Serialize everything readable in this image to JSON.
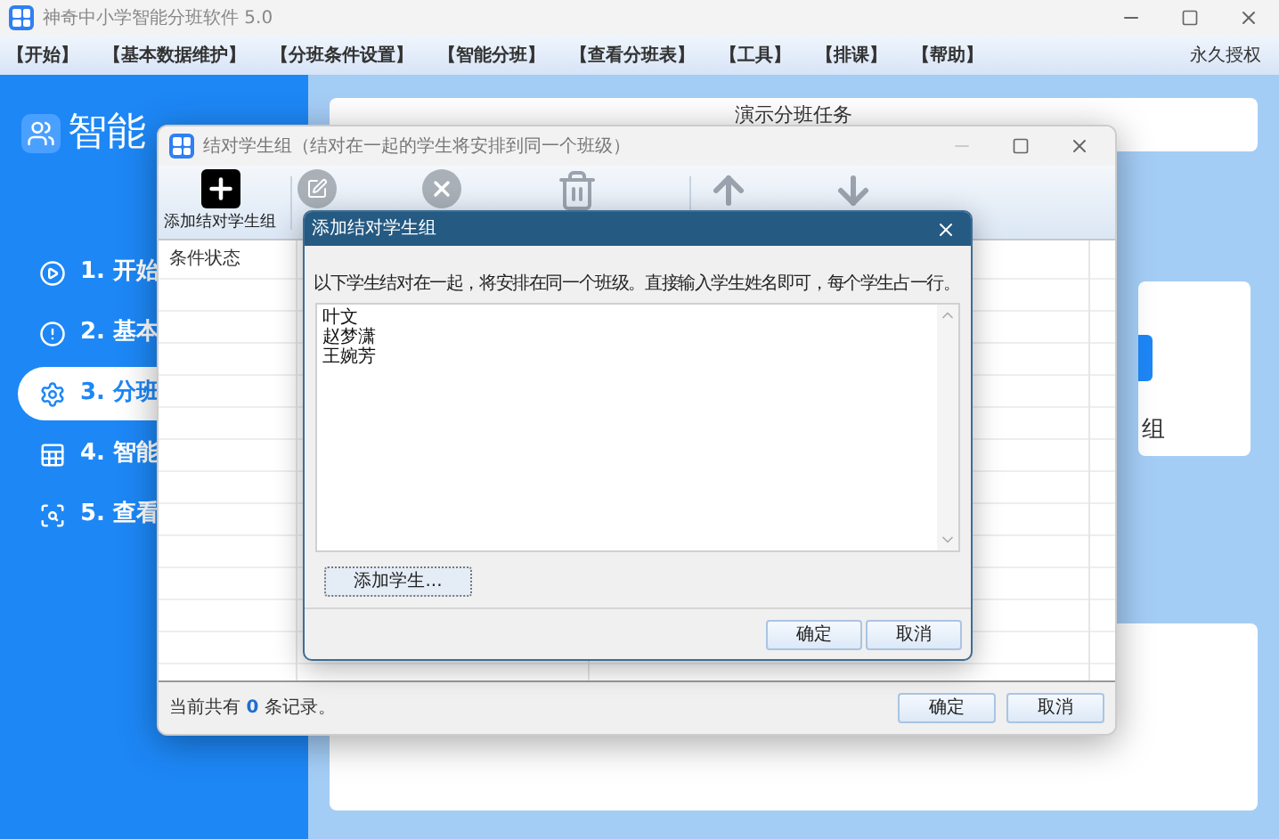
{
  "window": {
    "title": "神奇中小学智能分班软件 5.0"
  },
  "menu": {
    "items": [
      "【开始】",
      "【基本数据维护】",
      "【分班条件设置】",
      "【智能分班】",
      "【查看分班表】",
      "【工具】",
      "【排课】",
      "【帮助】"
    ],
    "license": "永久授权"
  },
  "sidebar": {
    "logo": "智能",
    "items": [
      {
        "label": "1. 开始",
        "selected": false
      },
      {
        "label": "2. 基本",
        "selected": false
      },
      {
        "label": "3. 分班",
        "selected": true
      },
      {
        "label": "4. 智能",
        "selected": false
      },
      {
        "label": "5. 查看",
        "selected": false
      }
    ]
  },
  "content": {
    "task_title": "演示分班任务",
    "card_label": "组"
  },
  "pair_window": {
    "title": "结对学生组（结对在一起的学生将安排到同一个班级）",
    "toolbar": [
      {
        "label": "添加结对学生组",
        "disabled": false
      },
      {
        "disabled": true
      },
      {
        "disabled": true
      },
      {
        "disabled": true
      },
      {
        "disabled": true
      },
      {
        "disabled": true
      }
    ],
    "table": {
      "columns": [
        "条件状态"
      ]
    },
    "status": {
      "prefix": "当前共有",
      "count": "0",
      "suffix": "条记录。"
    },
    "buttons": [
      "确定",
      "取消"
    ]
  },
  "dialog": {
    "title": "添加结对学生组",
    "instruction": "以下学生结对在一起，将安排在同一个班级。直接输入学生姓名即可，每个学生占一行。",
    "lines": [
      "叶文",
      "赵梦潇",
      "王婉芳"
    ],
    "add_button": "添加学生...",
    "buttons": [
      "确定",
      "取消"
    ]
  }
}
